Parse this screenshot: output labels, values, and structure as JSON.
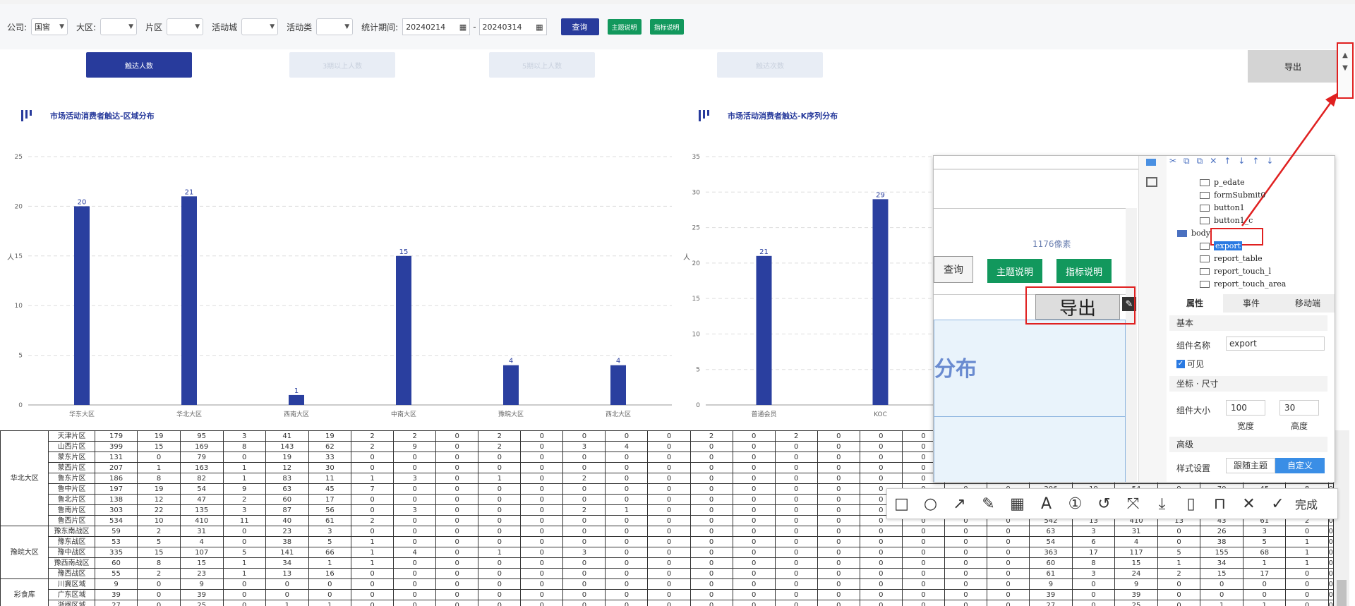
{
  "filters": {
    "company_label": "公司:",
    "company_value": "国窖",
    "region_label": "大区:",
    "area_label": "片区",
    "city_label": "活动城",
    "type_label": "活动类",
    "period_label": "统计期间:",
    "date_from": "20240214",
    "date_to": "20240314",
    "query_button": "查询",
    "theme_button": "主题说明",
    "metric_button": "指标说明"
  },
  "tabs": [
    "触达人数",
    "3期以上人数",
    "5期以上人数",
    "触达次数"
  ],
  "export_label": "导出",
  "scroll_up": "▲",
  "scroll_down": "▼",
  "charts": {
    "left_title": "市场活动消费者触达-区域分布",
    "right_title": "市场活动消费者触达-K序列分布",
    "left_ylabel": "人",
    "right_ylabel": "人"
  },
  "chart_data": [
    {
      "type": "bar",
      "title": "市场活动消费者触达-区域分布",
      "categories": [
        "华东大区",
        "华北大区",
        "西南大区",
        "中南大区",
        "豫皖大区",
        "西北大区"
      ],
      "values": [
        20,
        21,
        1,
        15,
        4,
        4
      ],
      "ylabel": "人",
      "ylim": [
        0,
        25
      ],
      "yticks": [
        0,
        5,
        10,
        15,
        20,
        25
      ],
      "grid": true,
      "color": "#2a3f9f"
    },
    {
      "type": "bar",
      "title": "市场活动消费者触达-K序列分布",
      "categories": [
        "普通会员",
        "KOC"
      ],
      "values": [
        21,
        29
      ],
      "ylabel": "人",
      "ylim": [
        0,
        35
      ],
      "yticks": [
        0,
        5,
        10,
        15,
        20,
        25,
        30,
        35
      ],
      "grid": true,
      "color": "#2a3f9f"
    }
  ],
  "table": {
    "groups": [
      {
        "name": "华北大区",
        "span": 9
      },
      {
        "name": "豫皖大区",
        "span": 5
      },
      {
        "name": "彩食库",
        "span": 3
      }
    ],
    "rows": [
      [
        "天津片区",
        "179",
        "19",
        "95",
        "3",
        "41",
        "19",
        "2",
        "2",
        "0",
        "2",
        "0",
        "0",
        "0",
        "0",
        "2",
        "0",
        "2",
        "0",
        "0",
        "0",
        "0",
        "0",
        "0",
        "0",
        "0",
        "0",
        "0",
        "0",
        "0",
        "0"
      ],
      [
        "山西片区",
        "399",
        "15",
        "169",
        "8",
        "143",
        "62",
        "2",
        "9",
        "0",
        "2",
        "0",
        "3",
        "4",
        "0",
        "0",
        "0",
        "0",
        "0",
        "0",
        "0",
        "0",
        "0",
        "0",
        "0",
        "0",
        "0",
        "0",
        "0",
        "0",
        "0"
      ],
      [
        "蒙东片区",
        "131",
        "0",
        "79",
        "0",
        "19",
        "33",
        "0",
        "0",
        "0",
        "0",
        "0",
        "0",
        "0",
        "0",
        "0",
        "0",
        "0",
        "0",
        "0",
        "0",
        "0",
        "0",
        "0",
        "0",
        "0",
        "0",
        "0",
        "0",
        "0",
        "0"
      ],
      [
        "蒙西片区",
        "207",
        "1",
        "163",
        "1",
        "12",
        "30",
        "0",
        "0",
        "0",
        "0",
        "0",
        "0",
        "0",
        "0",
        "0",
        "0",
        "0",
        "0",
        "0",
        "0",
        "0",
        "0",
        "0",
        "0",
        "0",
        "0",
        "0",
        "0",
        "0",
        "0"
      ],
      [
        "鲁东片区",
        "186",
        "8",
        "82",
        "1",
        "83",
        "11",
        "1",
        "3",
        "0",
        "1",
        "0",
        "2",
        "0",
        "0",
        "0",
        "0",
        "0",
        "0",
        "0",
        "0",
        "0",
        "0",
        "0",
        "0",
        "0",
        "0",
        "0",
        "0",
        "0",
        "0"
      ],
      [
        "鲁中片区",
        "197",
        "19",
        "54",
        "9",
        "63",
        "45",
        "7",
        "0",
        "0",
        "0",
        "0",
        "0",
        "0",
        "0",
        "0",
        "0",
        "0",
        "0",
        "0",
        "0",
        "0",
        "0",
        "206",
        "19",
        "54",
        "9",
        "70",
        "45",
        "8",
        "0"
      ],
      [
        "鲁北片区",
        "138",
        "12",
        "47",
        "2",
        "60",
        "17",
        "0",
        "0",
        "0",
        "0",
        "0",
        "0",
        "0",
        "0",
        "0",
        "0",
        "0",
        "0",
        "0",
        "0",
        "0",
        "0",
        "0",
        "0",
        "0",
        "0",
        "0",
        "0",
        "0",
        "0"
      ],
      [
        "鲁南片区",
        "303",
        "22",
        "135",
        "3",
        "87",
        "56",
        "0",
        "3",
        "0",
        "0",
        "0",
        "2",
        "1",
        "0",
        "0",
        "0",
        "0",
        "0",
        "0",
        "0",
        "0",
        "0",
        "0",
        "0",
        "0",
        "0",
        "0",
        "0",
        "0",
        "0"
      ],
      [
        "鲁西片区",
        "534",
        "10",
        "410",
        "11",
        "40",
        "61",
        "2",
        "0",
        "0",
        "0",
        "0",
        "0",
        "0",
        "0",
        "0",
        "0",
        "0",
        "0",
        "0",
        "0",
        "0",
        "0",
        "542",
        "13",
        "410",
        "13",
        "43",
        "61",
        "2",
        "0"
      ],
      [
        "豫东南战区",
        "59",
        "2",
        "31",
        "0",
        "23",
        "3",
        "0",
        "0",
        "0",
        "0",
        "0",
        "0",
        "0",
        "0",
        "0",
        "0",
        "0",
        "0",
        "0",
        "0",
        "0",
        "0",
        "63",
        "3",
        "31",
        "0",
        "26",
        "3",
        "0",
        "0"
      ],
      [
        "豫东战区",
        "53",
        "5",
        "4",
        "0",
        "38",
        "5",
        "1",
        "0",
        "0",
        "0",
        "0",
        "0",
        "0",
        "0",
        "0",
        "0",
        "0",
        "0",
        "0",
        "0",
        "0",
        "0",
        "54",
        "6",
        "4",
        "0",
        "38",
        "5",
        "1",
        "0"
      ],
      [
        "豫中战区",
        "335",
        "15",
        "107",
        "5",
        "141",
        "66",
        "1",
        "4",
        "0",
        "1",
        "0",
        "3",
        "0",
        "0",
        "0",
        "0",
        "0",
        "0",
        "0",
        "0",
        "0",
        "0",
        "363",
        "17",
        "117",
        "5",
        "155",
        "68",
        "1",
        "0"
      ],
      [
        "豫西南战区",
        "60",
        "8",
        "15",
        "1",
        "34",
        "1",
        "1",
        "0",
        "0",
        "0",
        "0",
        "0",
        "0",
        "0",
        "0",
        "0",
        "0",
        "0",
        "0",
        "0",
        "0",
        "0",
        "60",
        "8",
        "15",
        "1",
        "34",
        "1",
        "1",
        "0"
      ],
      [
        "豫西战区",
        "55",
        "2",
        "23",
        "1",
        "13",
        "16",
        "0",
        "0",
        "0",
        "0",
        "0",
        "0",
        "0",
        "0",
        "0",
        "0",
        "0",
        "0",
        "0",
        "0",
        "0",
        "0",
        "61",
        "3",
        "24",
        "2",
        "15",
        "17",
        "0",
        "0"
      ],
      [
        "川冀区域",
        "9",
        "0",
        "9",
        "0",
        "0",
        "0",
        "0",
        "0",
        "0",
        "0",
        "0",
        "0",
        "0",
        "0",
        "0",
        "0",
        "0",
        "0",
        "0",
        "0",
        "0",
        "0",
        "9",
        "0",
        "9",
        "0",
        "0",
        "0",
        "0",
        "0"
      ],
      [
        "广东区域",
        "39",
        "0",
        "39",
        "0",
        "0",
        "0",
        "0",
        "0",
        "0",
        "0",
        "0",
        "0",
        "0",
        "0",
        "0",
        "0",
        "0",
        "0",
        "0",
        "0",
        "0",
        "0",
        "39",
        "0",
        "39",
        "0",
        "0",
        "0",
        "0",
        "0"
      ],
      [
        "浙闽区域",
        "27",
        "0",
        "25",
        "0",
        "1",
        "1",
        "0",
        "0",
        "0",
        "0",
        "0",
        "0",
        "0",
        "0",
        "0",
        "0",
        "0",
        "0",
        "0",
        "0",
        "0",
        "0",
        "27",
        "0",
        "25",
        "0",
        "1",
        "1",
        "0",
        "0"
      ]
    ]
  },
  "designer": {
    "btn_query": "查询",
    "btn_theme": "主题说明",
    "btn_metric": "指标说明",
    "pixel_hint": "1176像素",
    "export_preview": "导出",
    "dist_text": "分布",
    "tree_items": [
      "p_edate",
      "formSubmit0",
      "button1",
      "button1_c",
      "body",
      "export",
      "report_table",
      "report_touch_l",
      "report_touch_area"
    ],
    "tabs": [
      "属性",
      "事件",
      "移动端"
    ],
    "section_basic": "基本",
    "name_label": "组件名称",
    "name_value": "export",
    "visible_label": "可见",
    "section_pos": "坐标 · 尺寸",
    "size_label": "组件大小",
    "width_value": "100",
    "height_value": "30",
    "width_label": "宽度",
    "height_label": "高度",
    "section_adv": "高级",
    "style_label": "样式设置",
    "follow_theme": "跟随主题",
    "custom": "自定义"
  },
  "annot_toolbar": {
    "done_label": "完成"
  }
}
